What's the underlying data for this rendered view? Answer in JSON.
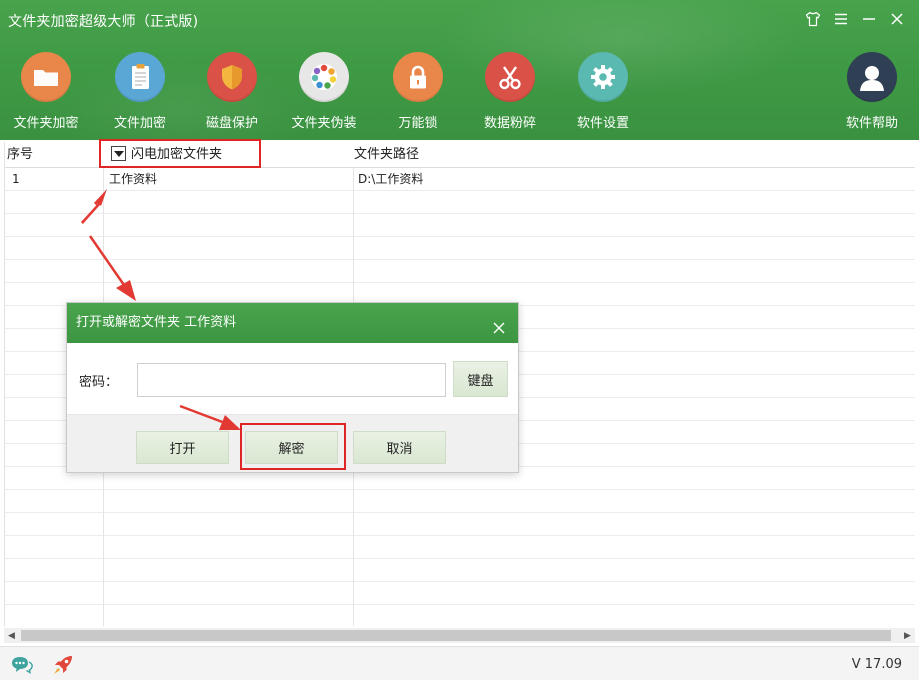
{
  "app": {
    "title": "文件夹加密超级大师（正式版)"
  },
  "window_controls": [
    "skin-icon",
    "menu-icon",
    "minimize-icon",
    "close-icon"
  ],
  "toolbar": {
    "items": [
      {
        "label": "文件夹加密",
        "icon": "folder-icon",
        "color": "#e9874a"
      },
      {
        "label": "文件加密",
        "icon": "clipboard-icon",
        "color": "#5aa7d6"
      },
      {
        "label": "磁盘保护",
        "icon": "shield-icon",
        "color": "#d95147"
      },
      {
        "label": "文件夹伪装",
        "icon": "palette-icon",
        "color": "#e7e7e7"
      },
      {
        "label": "万能锁",
        "icon": "lock-icon",
        "color": "#e9874a"
      },
      {
        "label": "数据粉碎",
        "icon": "scissors-icon",
        "color": "#d95147"
      },
      {
        "label": "软件设置",
        "icon": "gear-icon",
        "color": "#5ab9b0"
      },
      {
        "label": "软件帮助",
        "icon": "user-icon",
        "color": "#2f3f54"
      }
    ]
  },
  "table": {
    "columns": [
      "序号",
      "闪电加密文件夹",
      "文件夹路径"
    ],
    "rows": [
      {
        "index": "1",
        "name": "工作资料",
        "path": "D:\\工作资料"
      }
    ]
  },
  "dialog": {
    "title": "打开或解密文件夹 工作资料",
    "password_label": "密码：",
    "password_value": "",
    "keyboard_label": "键盘",
    "open_label": "打开",
    "decrypt_label": "解密",
    "cancel_label": "取消"
  },
  "status": {
    "version": "V 17.09"
  },
  "colors": {
    "header_green": "#3f9a45",
    "annotation_red": "#e02525"
  }
}
